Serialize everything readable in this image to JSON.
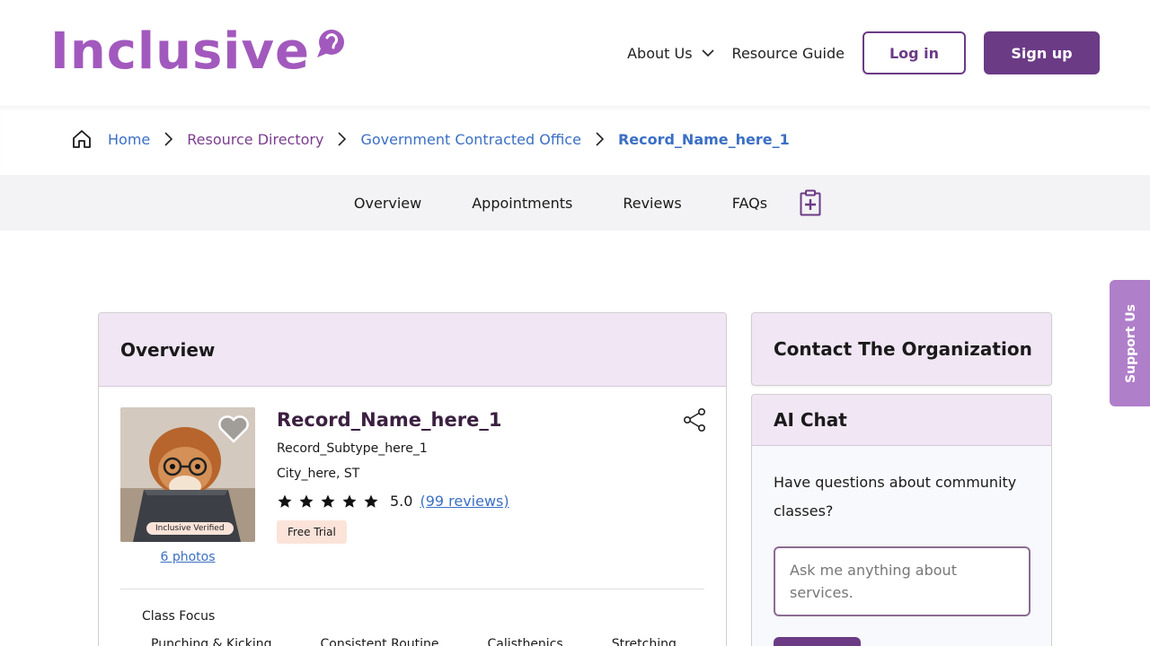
{
  "header": {
    "logo_text": "Inclusive",
    "nav": {
      "about": "About Us",
      "resource_guide": "Resource Guide",
      "login": "Log in",
      "signup": "Sign up"
    }
  },
  "breadcrumb": {
    "home": "Home",
    "directory": "Resource Directory",
    "office": "Government Contracted Office",
    "current": "Record_Name_here_1"
  },
  "tabs": {
    "overview": "Overview",
    "appointments": "Appointments",
    "reviews": "Reviews",
    "faqs": "FAQs"
  },
  "overview": {
    "title": "Overview",
    "record_name": "Record_Name_here_1",
    "subtype": "Record_Subtype_here_1",
    "city": "City_here, ST",
    "rating": "5.0",
    "stars": 5,
    "reviews_link": "(99 reviews)",
    "tag": "Free Trial",
    "verified_badge": "Inclusive Verified",
    "photos_link": "6 photos",
    "class_focus_label": "Class Focus",
    "class_focus_items": [
      "Punching & Kicking",
      "Consistent Routine",
      "Calisthenics",
      "Stretching"
    ]
  },
  "contact": {
    "title": "Contact The Organization"
  },
  "ai_chat": {
    "title": "AI Chat",
    "question": "Have questions about community classes?",
    "placeholder": "Ask me anything about services."
  },
  "support_tab": {
    "label": "Support Us"
  },
  "colors": {
    "brand_purple": "#a259bd",
    "dark_purple": "#6b3b86",
    "link_blue": "#3b6fc4",
    "card_header": "#f1e6f3",
    "tag_peach": "#fbe3d9"
  },
  "icons": {
    "logo": "chat-bubble-icon",
    "about_chevron": "chevron-down-icon",
    "breadcrumb_home": "home-icon",
    "breadcrumb_separator": "chevron-right-icon",
    "tab_extra": "clipboard-plus-icon",
    "favorite": "heart-icon",
    "share": "share-icon",
    "rating": "star-icon"
  }
}
